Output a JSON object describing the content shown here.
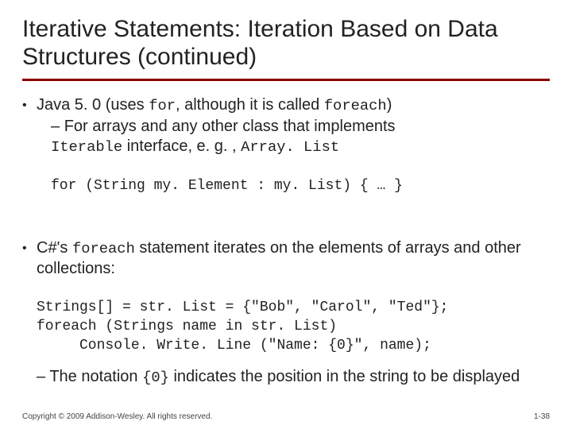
{
  "title": "Iterative Statements: Iteration Based on Data Structures (continued)",
  "items": [
    {
      "pre": "Java 5. 0 (uses ",
      "code1": "for",
      "mid": ", although it is called ",
      "code2": "foreach",
      "post": ")",
      "sub_pre": "For arrays and any other class that implements ",
      "sub_code1": "Iterable",
      "sub_mid": " interface, e. g. , ",
      "sub_code2": "Array. List",
      "codeblock": "for (String my. Element : my. List) { … }"
    },
    {
      "pre": "C#'s ",
      "code1": "foreach",
      "post": " statement iterates on the elements of arrays and other collections:",
      "codeblock": "Strings[] = str. List = {\"Bob\", \"Carol\", \"Ted\"};\nforeach (Strings name in str. List)\n     Console. Write. Line (\"Name: {0}\", name);",
      "note_pre": "The notation ",
      "note_code": "{0}",
      "note_post": " indicates the position in the string to be displayed"
    }
  ],
  "footer": {
    "copyright": "Copyright © 2009 Addison-Wesley. All rights reserved.",
    "page": "1-38"
  }
}
